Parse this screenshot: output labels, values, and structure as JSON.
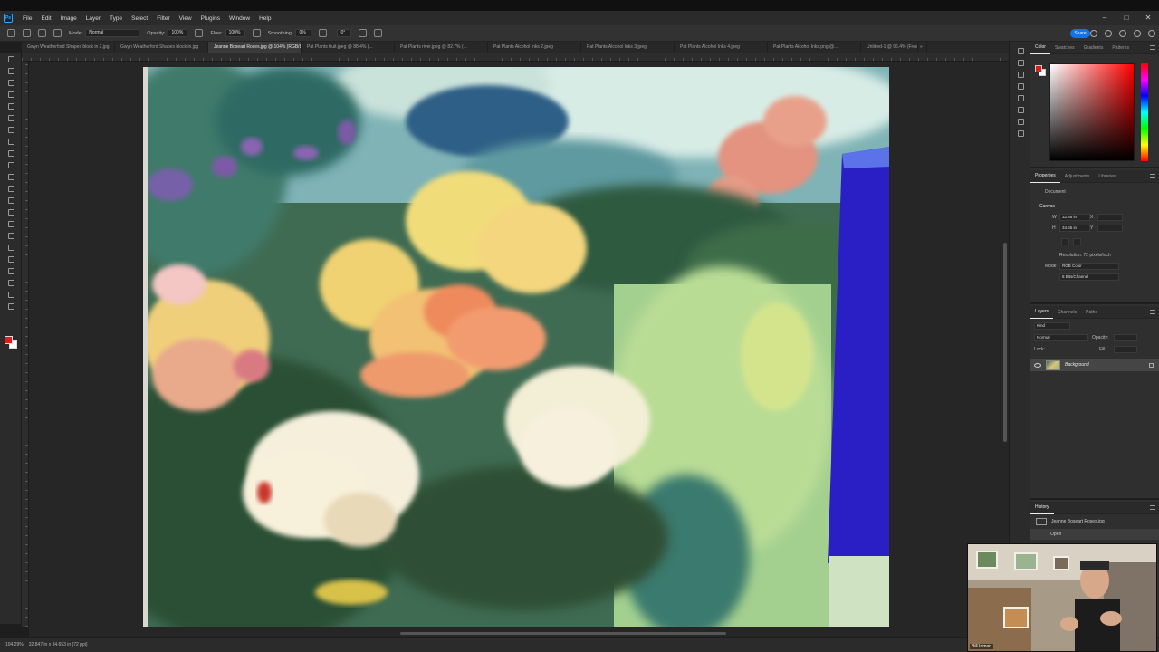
{
  "app": {
    "logo": "Ps"
  },
  "menu": [
    "File",
    "Edit",
    "Image",
    "Layer",
    "Type",
    "Select",
    "Filter",
    "View",
    "Plugins",
    "Window",
    "Help"
  ],
  "window_controls": [
    "–",
    "□",
    "✕"
  ],
  "options_bar": {
    "mode_label": "Mode:",
    "mode_value": "Normal",
    "opacity_label": "Opacity:",
    "opacity_value": "100%",
    "flow_label": "Flow:",
    "flow_value": "100%",
    "smoothing_label": "Smoothing:",
    "smoothing_value": "0%",
    "angle_value": "0°",
    "share_label": "Share"
  },
  "tabs": [
    {
      "label": "Gwyn Weatherford Shapes block in 2.jpg",
      "active": false
    },
    {
      "label": "Gwyn Weatherford Shapes block in.jpg",
      "active": false
    },
    {
      "label": "Jeanne Boseart Roses.jpg @ 104% (RGB/8#) *",
      "active": true
    },
    {
      "label": "Pat Plants fruit.jpeg @ 88.4% (...",
      "active": false
    },
    {
      "label": "Pat Plants river.jpeg @ 82.7% (...",
      "active": false
    },
    {
      "label": "Pat Plants Alcohol Inks 2.jpeg",
      "active": false
    },
    {
      "label": "Pat Plants Alcohol Inks 3.jpeg",
      "active": false
    },
    {
      "label": "Pat Plants Alcohol Inks 4.jpeg",
      "active": false
    },
    {
      "label": "Pat Plants Alcohol Inks.png @...",
      "active": false
    },
    {
      "label": "Untitled-1 @ 96.4% (Free",
      "active": false
    }
  ],
  "tabs_overflow": "»",
  "status": {
    "zoom": "104.29%",
    "doc_size": "32.847 in x 34.653 in (72 ppi)"
  },
  "color_panel": {
    "tabs": [
      "Color",
      "Swatches",
      "Gradients",
      "Patterns"
    ],
    "fg": "#e01b1b",
    "bg": "#ffffff"
  },
  "properties_panel": {
    "tabs": [
      "Properties",
      "Adjustments",
      "Libraries"
    ],
    "kind": "Document",
    "section": "Canvas",
    "w_label": "W",
    "w_value": "32.85 in",
    "h_label": "H",
    "h_value": "34.65 in",
    "x_label": "X",
    "y_label": "Y",
    "resolution": "Resolution: 72 pixels/inch",
    "mode_label": "Mode",
    "mode_value": "RGB Color",
    "bits_value": "8 Bits/Channel"
  },
  "layers_panel": {
    "tabs": [
      "Layers",
      "Channels",
      "Paths"
    ],
    "kind_placeholder": "Kind",
    "blend": "Normal",
    "opacity_label": "Opacity:",
    "lock_label": "Lock:",
    "fill_label": "Fill:",
    "layer_name": "Background"
  },
  "history_panel": {
    "title": "History",
    "snapshot": "Jeanne Boseart Roses.jpg",
    "step": "Open"
  },
  "webcam": {
    "name": "Bill Inman"
  }
}
